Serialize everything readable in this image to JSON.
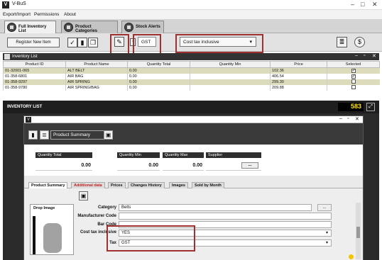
{
  "window": {
    "app_title": "V-BuS"
  },
  "menu": [
    "Export/Import",
    "Permissions",
    "About"
  ],
  "tabs": [
    {
      "label": "Full Inventory List"
    },
    {
      "label": "Product Categories"
    },
    {
      "label": "Stock Alerts"
    }
  ],
  "toolbar": {
    "register_label": "Register New Item",
    "tax_value": "GST",
    "tax_mode": "Cost tax inclusive"
  },
  "inventory_list": {
    "title": "Inventory List",
    "columns": [
      "Product ID",
      "Product Name",
      "Quantity Total",
      "Quantity Min",
      "Price",
      "Selected"
    ],
    "rows": [
      {
        "id": "01-32001-065",
        "name": "ALT BELT",
        "qty_total": "0.00",
        "qty_min": "",
        "price": "102.36",
        "selected": true
      },
      {
        "id": "01-358-6801",
        "name": "AIR BAG",
        "qty_total": "0.00",
        "qty_min": "",
        "price": "406.54",
        "selected": true
      },
      {
        "id": "01-358-9297",
        "name": "AIR SPRING",
        "qty_total": "0.00",
        "qty_min": "",
        "price": "299.30",
        "selected": false
      },
      {
        "id": "01-358-9780",
        "name": "AIR SPRING/BAG",
        "qty_total": "0.00",
        "qty_min": "",
        "price": "209.88",
        "selected": false
      }
    ]
  },
  "inventory_bar": {
    "label": "INVENTORY LIST",
    "count": "583"
  },
  "product_window": {
    "summary_selector": "Product Summary",
    "metrics": [
      {
        "label": "Quantity Total",
        "value": "0.00"
      },
      {
        "label": "Quantity Min",
        "value": "0.00"
      },
      {
        "label": "Quantity Max",
        "value": "0.00"
      },
      {
        "label": "Supplier",
        "value": ""
      }
    ],
    "supplier_btn": "...",
    "subtabs": [
      "Product Summary",
      "Additional data",
      "Prices",
      "Changes History",
      "Images",
      "Sold by Month"
    ],
    "drop_image_label": "Drop Image",
    "fields": {
      "category_label": "Category",
      "category_value": "Belts",
      "category_btn": "...",
      "manufacturer_label": "Manufacturer Code",
      "manufacturer_value": "",
      "barcode_label": "Bar Code",
      "barcode_value": "",
      "cost_tax_label": "Cost tax inclusive",
      "cost_tax_value": "YES",
      "tax_label": "Tax",
      "tax_value": "GST"
    }
  },
  "colors": {
    "highlight": "#a03030",
    "count": "#ffe500",
    "alt_row": "#dcdcbc"
  },
  "icons": [
    "app-icon",
    "pencil-icon",
    "checkmark-icon",
    "trash-icon",
    "copy-icon",
    "notes-icon",
    "dollar-icon",
    "save-icon"
  ]
}
